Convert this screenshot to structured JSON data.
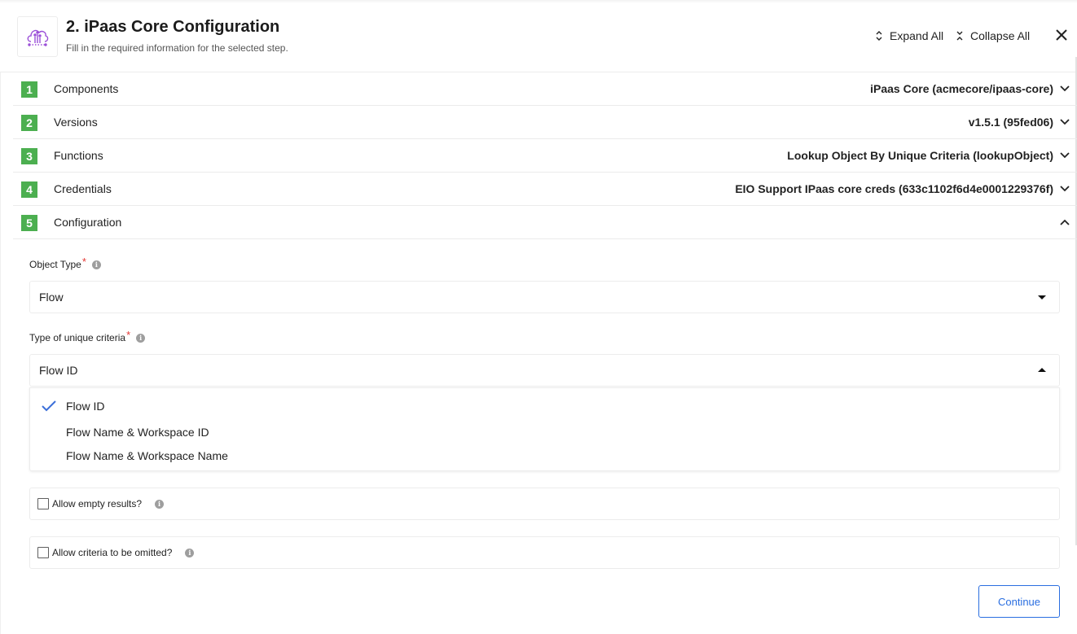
{
  "header": {
    "title": "2. iPaas Core Configuration",
    "subtitle": "Fill in the required information for the selected step.",
    "logo_icon": "cloud-network-icon",
    "expand_all_label": "Expand All",
    "collapse_all_label": "Collapse All",
    "close_icon": "close-icon"
  },
  "colors": {
    "step_badge": "#4caf50",
    "accent": "#2a6ee0",
    "required": "#e53935",
    "logo": "#9b4fd8"
  },
  "steps": [
    {
      "number": "1",
      "label": "Components",
      "value": "iPaas Core (acmecore/ipaas-core)",
      "expanded": false
    },
    {
      "number": "2",
      "label": "Versions",
      "value": "v1.5.1 (95fed06)",
      "expanded": false
    },
    {
      "number": "3",
      "label": "Functions",
      "value": "Lookup Object By Unique Criteria (lookupObject)",
      "expanded": false
    },
    {
      "number": "4",
      "label": "Credentials",
      "value": "EIO Support IPaas core creds (633c1102f6d4e0001229376f)",
      "expanded": false
    },
    {
      "number": "5",
      "label": "Configuration",
      "value": "",
      "expanded": true
    }
  ],
  "configuration": {
    "object_type": {
      "label": "Object Type",
      "required_mark": "*",
      "info_icon": "i",
      "value": "Flow"
    },
    "criteria_type": {
      "label": "Type of unique criteria",
      "required_mark": "*",
      "info_icon": "i",
      "value": "Flow ID",
      "open": true,
      "options": [
        {
          "label": "Flow ID",
          "selected": true
        },
        {
          "label": "Flow Name & Workspace ID",
          "selected": false
        },
        {
          "label": "Flow Name & Workspace Name",
          "selected": false
        }
      ]
    },
    "allow_empty_results": {
      "label": "Allow empty results?",
      "info_icon": "i",
      "checked": false
    },
    "allow_criteria_omitted": {
      "label": "Allow criteria to be omitted?",
      "info_icon": "i",
      "checked": false
    }
  },
  "footer": {
    "continue_label": "Continue"
  }
}
